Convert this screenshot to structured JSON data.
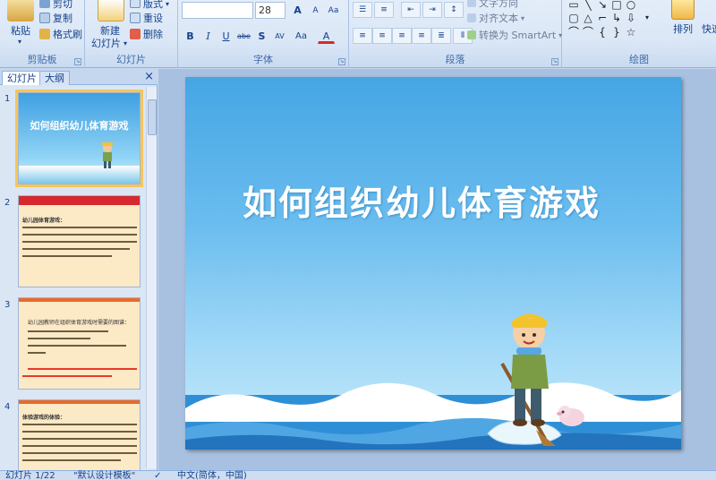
{
  "ribbon": {
    "clipboard": {
      "paste": "粘贴",
      "cut": "剪切",
      "copy": "复制",
      "format_painter": "格式刷",
      "label": "剪贴板"
    },
    "slides": {
      "new_slide": "新建",
      "new_slide_2": "幻灯片",
      "layout": "版式",
      "reset": "重设",
      "delete": "删除",
      "label": "幻灯片"
    },
    "font": {
      "font_name": "",
      "font_size": "28",
      "grow": "A",
      "shrink": "A",
      "clear": "Aa",
      "bold": "B",
      "italic": "I",
      "underline": "U",
      "strike": "abe",
      "shadow": "S",
      "spacing": "AV",
      "case": "Aa",
      "color": "A",
      "label": "字体"
    },
    "paragraph": {
      "text_direction": "文字方向",
      "align_text": "对齐文本",
      "smartart": "转换为 SmartArt",
      "label": "段落"
    },
    "drawing": {
      "arrange": "排列",
      "quick_styles": "快速",
      "label": "绘图"
    }
  },
  "panel": {
    "tab_slides": "幻灯片",
    "tab_outline": "大纲",
    "close": "×",
    "thumbs": [
      {
        "num": "1",
        "title": "如何组织幼儿体育游戏"
      },
      {
        "num": "2",
        "heading": "幼儿园体育游戏："
      },
      {
        "num": "3",
        "heading": "幼儿园教师在组织体育游戏时需要的图谱："
      },
      {
        "num": "4",
        "heading": "体验游戏的体验："
      }
    ]
  },
  "slide": {
    "title": "如何组织幼儿体育游戏"
  },
  "status": {
    "slide_count": "幻灯片 1/22",
    "theme": "\"默认设计模板\"",
    "language": "中文(简体，中国)"
  }
}
